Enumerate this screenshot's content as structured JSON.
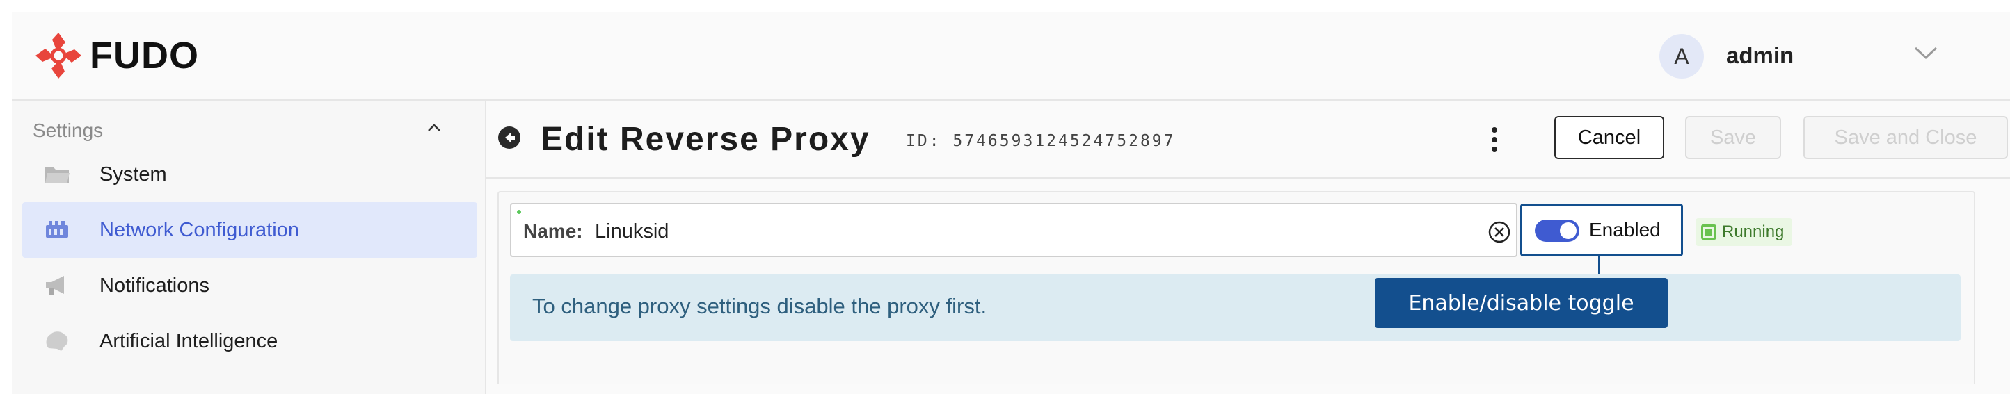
{
  "app": {
    "logo_text": "FUDO"
  },
  "user": {
    "avatar_initial": "A",
    "name": "admin"
  },
  "sidebar": {
    "section_title": "Settings",
    "items": [
      {
        "label": "System",
        "icon": "folder-icon",
        "active": false
      },
      {
        "label": "Network Configuration",
        "icon": "network-icon",
        "active": true
      },
      {
        "label": "Notifications",
        "icon": "megaphone-icon",
        "active": false
      },
      {
        "label": "Artificial Intelligence",
        "icon": "brain-icon",
        "active": false
      }
    ]
  },
  "page": {
    "title": "Edit Reverse Proxy",
    "id_text": "ID: 5746593124524752897"
  },
  "toolbar": {
    "cancel_label": "Cancel",
    "save_label": "Save",
    "save_close_label": "Save and Close"
  },
  "form": {
    "name_label": "Name:",
    "name_value": "Linuksid",
    "toggle_label": "Enabled",
    "toggle_state": true,
    "status": "Running",
    "info_message": "To change proxy settings disable the proxy first."
  },
  "annotation": {
    "tooltip": "Enable/disable toggle"
  },
  "colors": {
    "accent": "#3f5bd1",
    "brand_red": "#e8453c",
    "annotation": "#134f8e",
    "status_green": "#69c24f",
    "info_bg": "#dcebf2"
  }
}
